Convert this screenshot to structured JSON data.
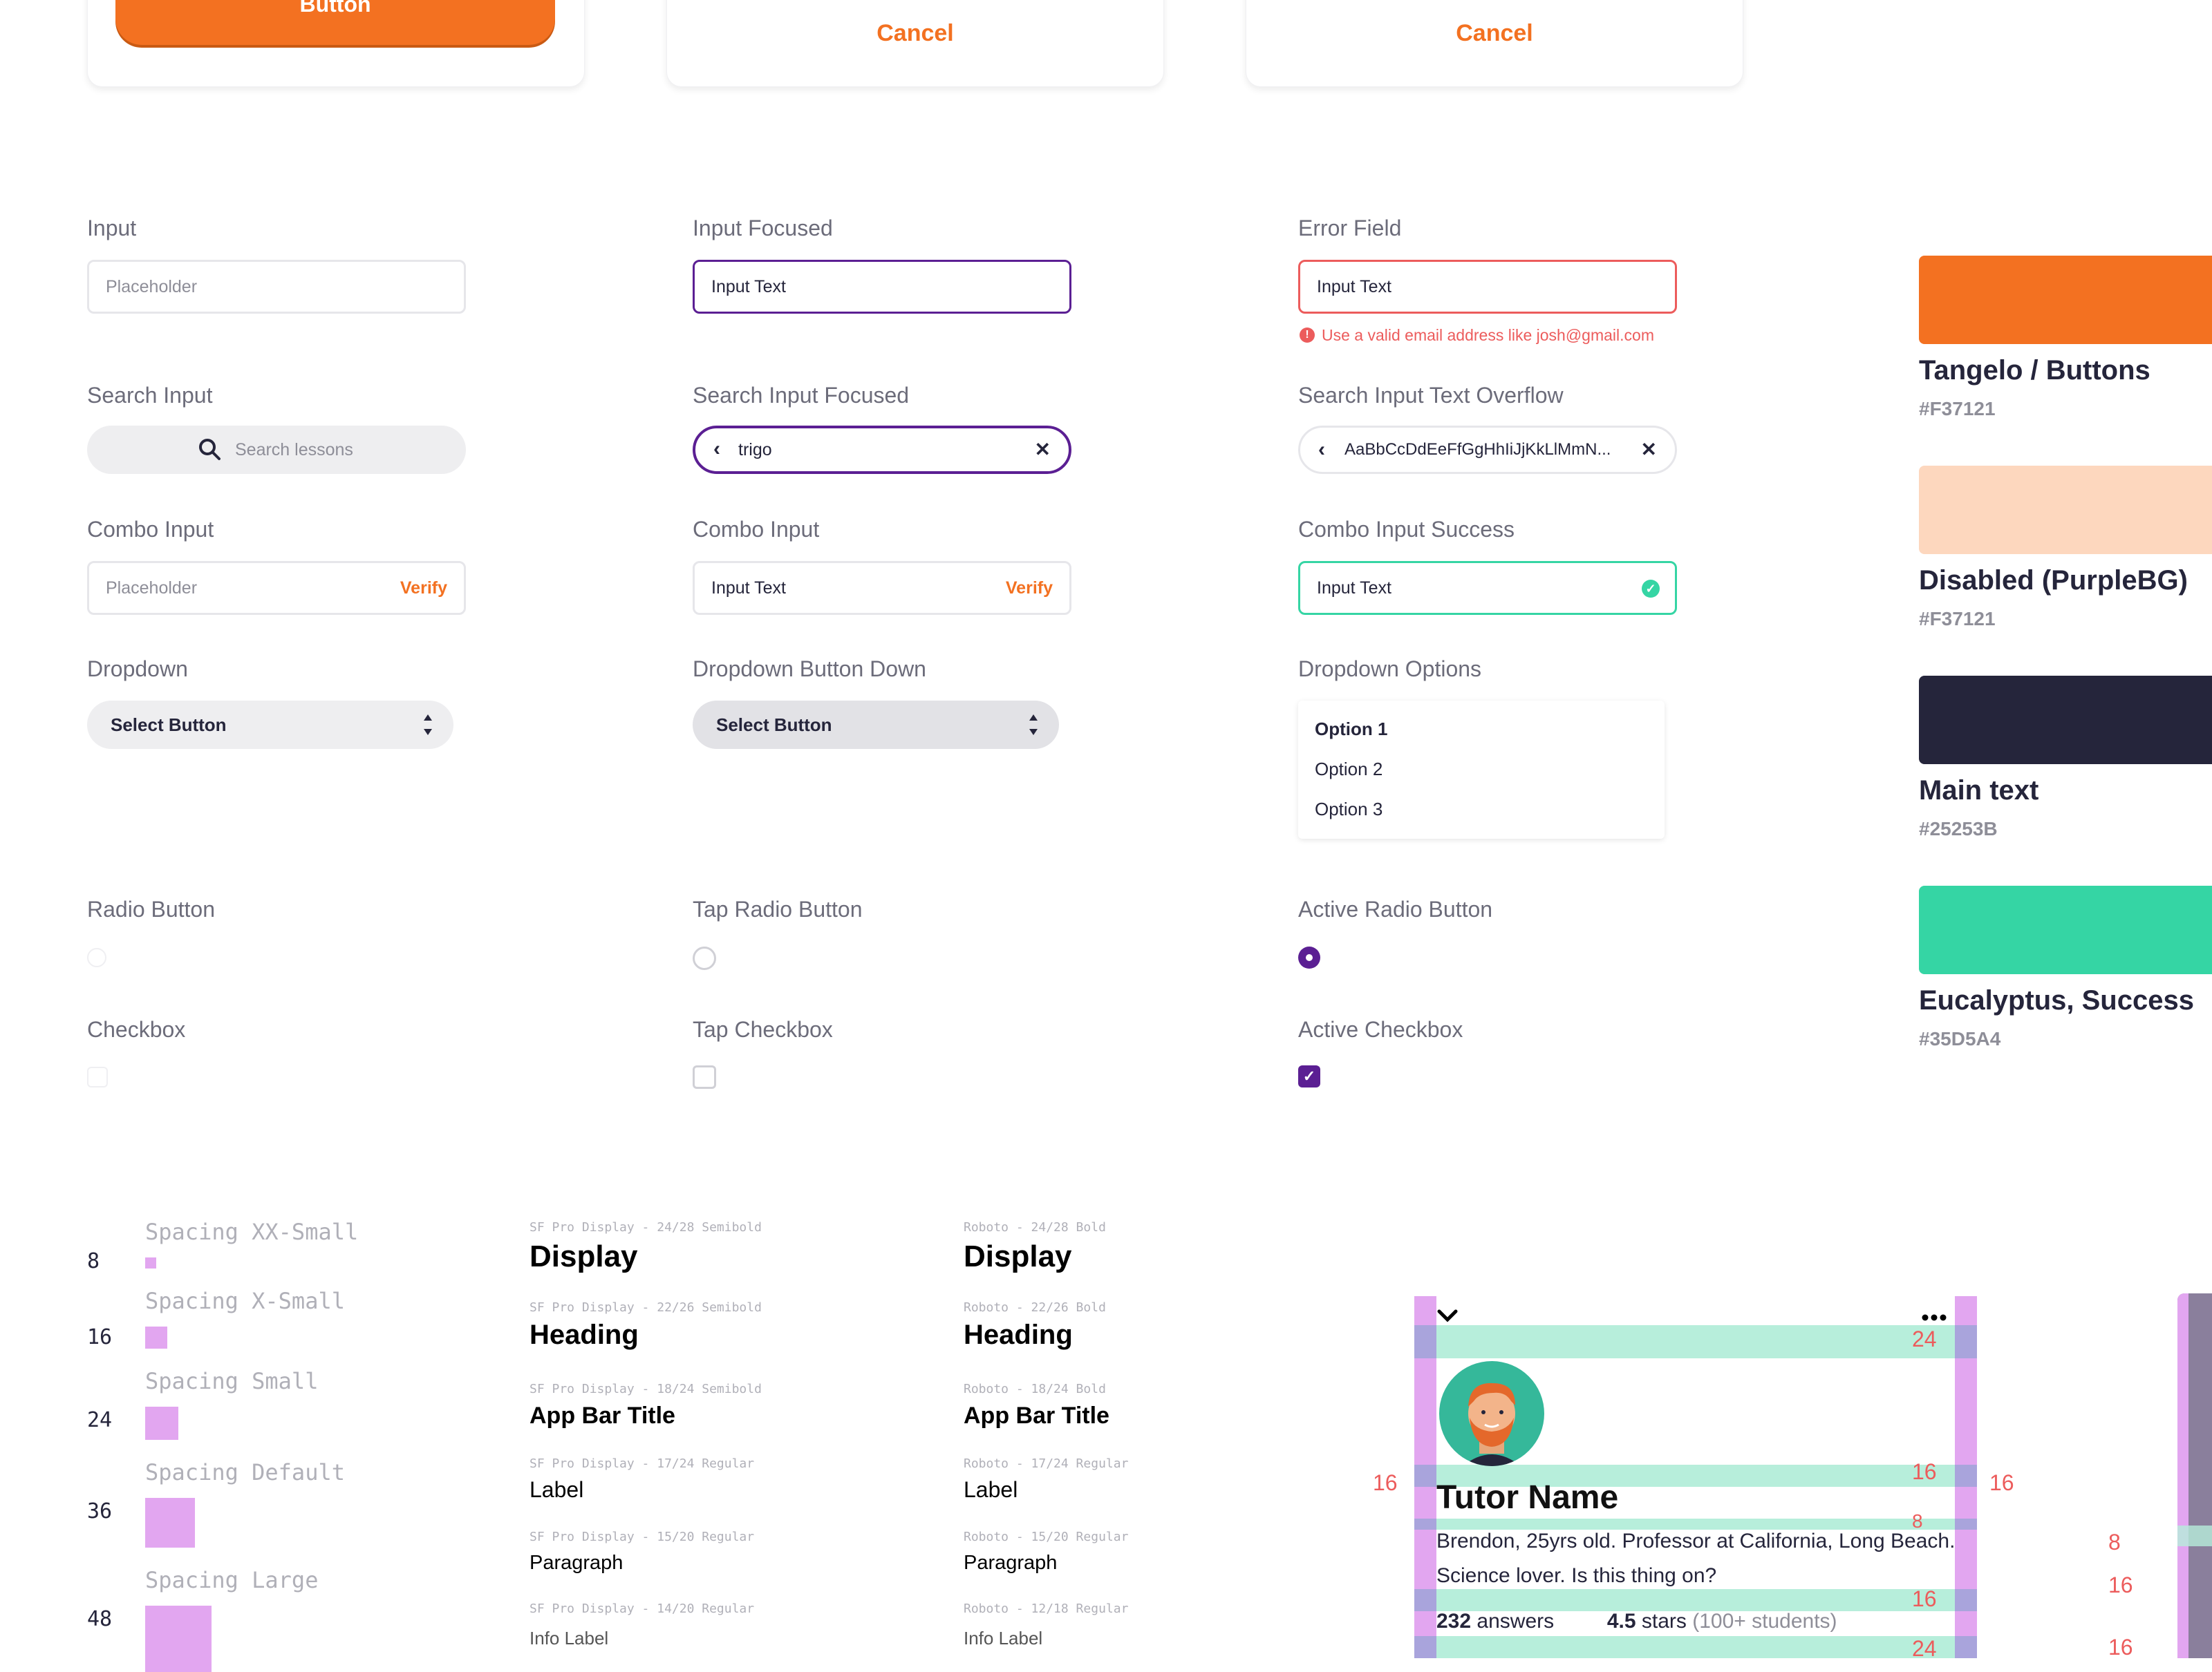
{
  "buttons": {
    "primary_label": "Button",
    "cancel_label_1": "Cancel",
    "cancel_label_2": "Cancel"
  },
  "inputs": {
    "input": {
      "label": "Input",
      "placeholder": "Placeholder"
    },
    "input_focused": {
      "label": "Input Focused",
      "value": "Input Text"
    },
    "error_field": {
      "label": "Error Field",
      "value": "Input Text",
      "error": "Use a valid email address like josh@gmail.com"
    },
    "search_input": {
      "label": "Search Input",
      "placeholder": "Search lessons"
    },
    "search_focused": {
      "label": "Search Input Focused",
      "value": "trigo"
    },
    "search_overflow": {
      "label": "Search Input Text Overflow",
      "value": "AaBbCcDdEeFfGgHhIiJjKkLlMmN..."
    },
    "combo_1": {
      "label": "Combo Input",
      "placeholder": "Placeholder",
      "action": "Verify"
    },
    "combo_2": {
      "label": "Combo Input",
      "value": "Input Text",
      "action": "Verify"
    },
    "combo_success": {
      "label": "Combo Input Success",
      "value": "Input Text"
    }
  },
  "dropdowns": {
    "dropdown": {
      "label": "Dropdown",
      "value": "Select Button"
    },
    "dropdown_down": {
      "label": "Dropdown Button Down",
      "value": "Select Button"
    },
    "options": {
      "label": "Dropdown Options",
      "items": [
        "Option 1",
        "Option 2",
        "Option 3"
      ]
    }
  },
  "controls": {
    "radio": "Radio Button",
    "tap_radio": "Tap Radio Button",
    "active_radio": "Active Radio Button",
    "checkbox": "Checkbox",
    "tap_checkbox": "Tap Checkbox",
    "active_checkbox": "Active Checkbox"
  },
  "colors": [
    {
      "name": "Tangelo / Buttons",
      "hex": "#F37121",
      "swatch": "#F37121"
    },
    {
      "name": "Disabled (PurpleBG)",
      "hex": "#F37121",
      "swatch": "#FDD7BE"
    },
    {
      "name": "Main text",
      "hex": "#25253B",
      "swatch": "#25253B"
    },
    {
      "name": "Eucalyptus, Success",
      "hex": "#35D5A4",
      "swatch": "#35D5A4"
    }
  ],
  "spacing": [
    {
      "name": "Spacing XX-Small",
      "value": "8"
    },
    {
      "name": "Spacing X-Small",
      "value": "16"
    },
    {
      "name": "Spacing Small",
      "value": "24"
    },
    {
      "name": "Spacing Default",
      "value": "36"
    },
    {
      "name": "Spacing Large",
      "value": "48"
    }
  ],
  "typography_sf": [
    {
      "meta": "SF Pro Display - 24/28 Semibold",
      "sample": "Display"
    },
    {
      "meta": "SF Pro Display - 22/26 Semibold",
      "sample": "Heading"
    },
    {
      "meta": "SF Pro Display - 18/24 Semibold",
      "sample": "App Bar Title"
    },
    {
      "meta": "SF Pro Display - 17/24 Regular",
      "sample": "Label"
    },
    {
      "meta": "SF Pro Display - 15/20 Regular",
      "sample": "Paragraph"
    },
    {
      "meta": "SF Pro Display - 14/20 Regular",
      "sample": "Info Label"
    }
  ],
  "typography_roboto": [
    {
      "meta": "Roboto - 24/28 Bold",
      "sample": "Display"
    },
    {
      "meta": "Roboto - 22/26 Bold",
      "sample": "Heading"
    },
    {
      "meta": "Roboto - 18/24 Bold",
      "sample": "App Bar Title"
    },
    {
      "meta": "Roboto - 17/24 Regular",
      "sample": "Label"
    },
    {
      "meta": "Roboto - 15/20 Regular",
      "sample": "Paragraph"
    },
    {
      "meta": "Roboto - 12/18 Regular",
      "sample": "Info Label"
    }
  ],
  "tutor_card": {
    "name": "Tutor Name",
    "bio": "Brendon, 25yrs old. Professor at California, Long Beach. Science lover. Is this thing on?",
    "answers_count": "232",
    "answers_label": "answers",
    "rating": "4.5",
    "stars_label": "stars",
    "students": "(100+ students)",
    "spacing_labels": {
      "top": "24",
      "left": "16",
      "right_in": "16",
      "right_out": "16",
      "name_gap": "8",
      "bio_gap": "16",
      "bottom": "24"
    }
  },
  "edge_labels": {
    "a": "8",
    "b": "16",
    "c": "16"
  }
}
